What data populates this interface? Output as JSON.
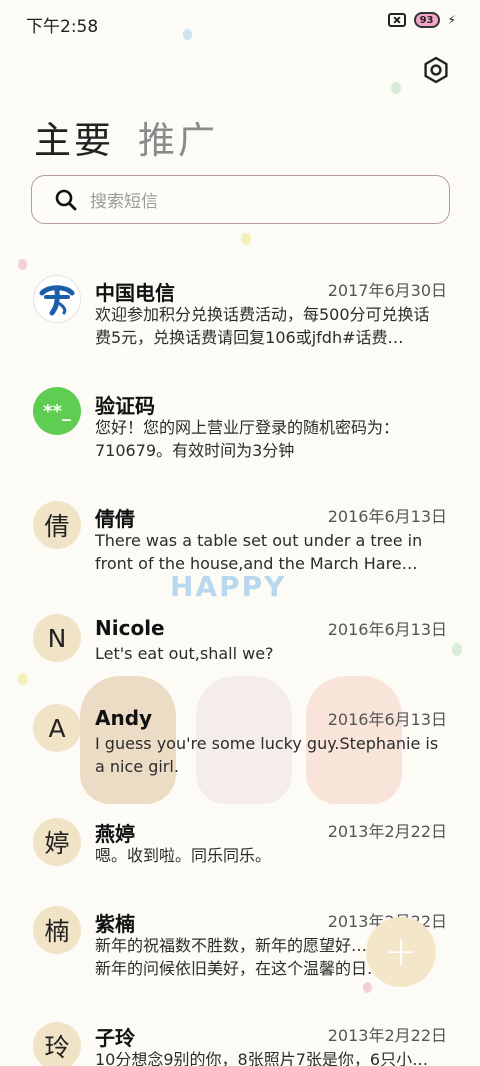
{
  "status_bar": {
    "time": "下午2:58",
    "battery": "93"
  },
  "tabs": [
    {
      "label": "主要",
      "active": true
    },
    {
      "label": "推广",
      "active": false
    }
  ],
  "search": {
    "placeholder": "搜索短信"
  },
  "conversations": [
    {
      "avatar": "",
      "avatar_icon": "china-telecom-logo-icon",
      "name": "中国电信",
      "date": "2017年6月30日",
      "snippet": "欢迎参加积分兑换话费活动，每500分可兑换话费5元，兑换话费请回复106或jfdh#话费…"
    },
    {
      "avatar": "**_",
      "avatar_icon": "verification-code-icon",
      "name": "验证码",
      "date": "",
      "snippet": "您好！您的网上营业厅登录的随机密码为：710679。有效时间为3分钟"
    },
    {
      "avatar": "倩",
      "name": "倩倩",
      "date": "2016年6月13日",
      "snippet": "There was a table set out under a tree in front of the house,and the March Hare an…"
    },
    {
      "avatar": "N",
      "name": "Nicole",
      "date": "2016年6月13日",
      "snippet": "Let's eat out,shall we?"
    },
    {
      "avatar": "A",
      "name": "Andy",
      "date": "2016年6月13日",
      "snippet": "I guess you're some lucky guy.Stephanie is a nice girl."
    },
    {
      "avatar": "婷",
      "name": "燕婷",
      "date": "2013年2月22日",
      "snippet": "嗯。收到啦。同乐同乐。"
    },
    {
      "avatar": "楠",
      "name": "紫楠",
      "date": "2013年2月22日",
      "snippet": "新年的祝福数不胜数，新年的愿望好……新年的问候依旧美好，在这个温馨的日子里…"
    },
    {
      "avatar": "玲",
      "name": "子玲",
      "date": "2013年2月22日",
      "snippet": "10分想念9别的你，8张照片7张是你，6只小…"
    }
  ],
  "decor": {
    "happy_text": "HAPPY"
  },
  "fab": {
    "label": "+"
  },
  "colors": {
    "background": "#fcfbf6",
    "avatar_bg": "#f0e3c6",
    "verify_green": "#5fcd52",
    "telecom_blue": "#1b5faa"
  }
}
